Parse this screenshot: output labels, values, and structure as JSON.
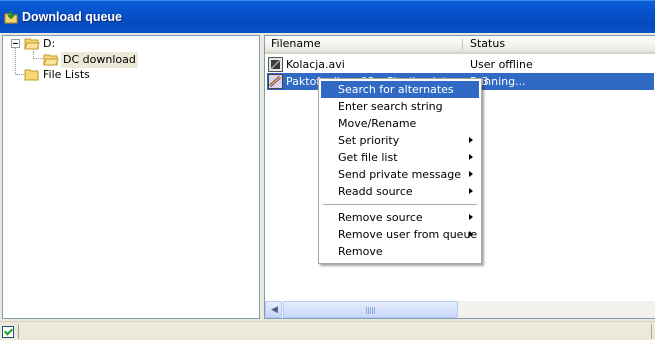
{
  "window": {
    "title": "Download queue"
  },
  "tree": {
    "root": "D:",
    "child": "DC download",
    "file_lists": "File Lists"
  },
  "list": {
    "columns": [
      "Filename",
      "Status"
    ],
    "rows": [
      {
        "filename": "Kolacja.avi",
        "status": "User offline",
        "selected": false,
        "icon": "video-file-icon"
      },
      {
        "filename": "Paktofonika - 02 - Chwile ulotne.mp3",
        "status": "Running...",
        "selected": true,
        "icon": "audio-file-icon"
      }
    ]
  },
  "context_menu": {
    "items": [
      {
        "label": "Search for alternates",
        "highlighted": true,
        "submenu": false
      },
      {
        "label": "Enter search string",
        "submenu": false
      },
      {
        "label": "Move/Rename",
        "submenu": false
      },
      {
        "label": "Set priority",
        "submenu": true
      },
      {
        "label": "Get file list",
        "submenu": true
      },
      {
        "label": "Send private message",
        "submenu": true
      },
      {
        "label": "Readd source",
        "submenu": true
      },
      {
        "label": "Remove source",
        "submenu": true
      },
      {
        "label": "Remove user from queue",
        "submenu": true
      },
      {
        "label": "Remove",
        "submenu": false
      }
    ]
  },
  "colors": {
    "titlebar": "#0651C9",
    "selection": "#316AC5",
    "window_bg": "#ECE9D8"
  }
}
